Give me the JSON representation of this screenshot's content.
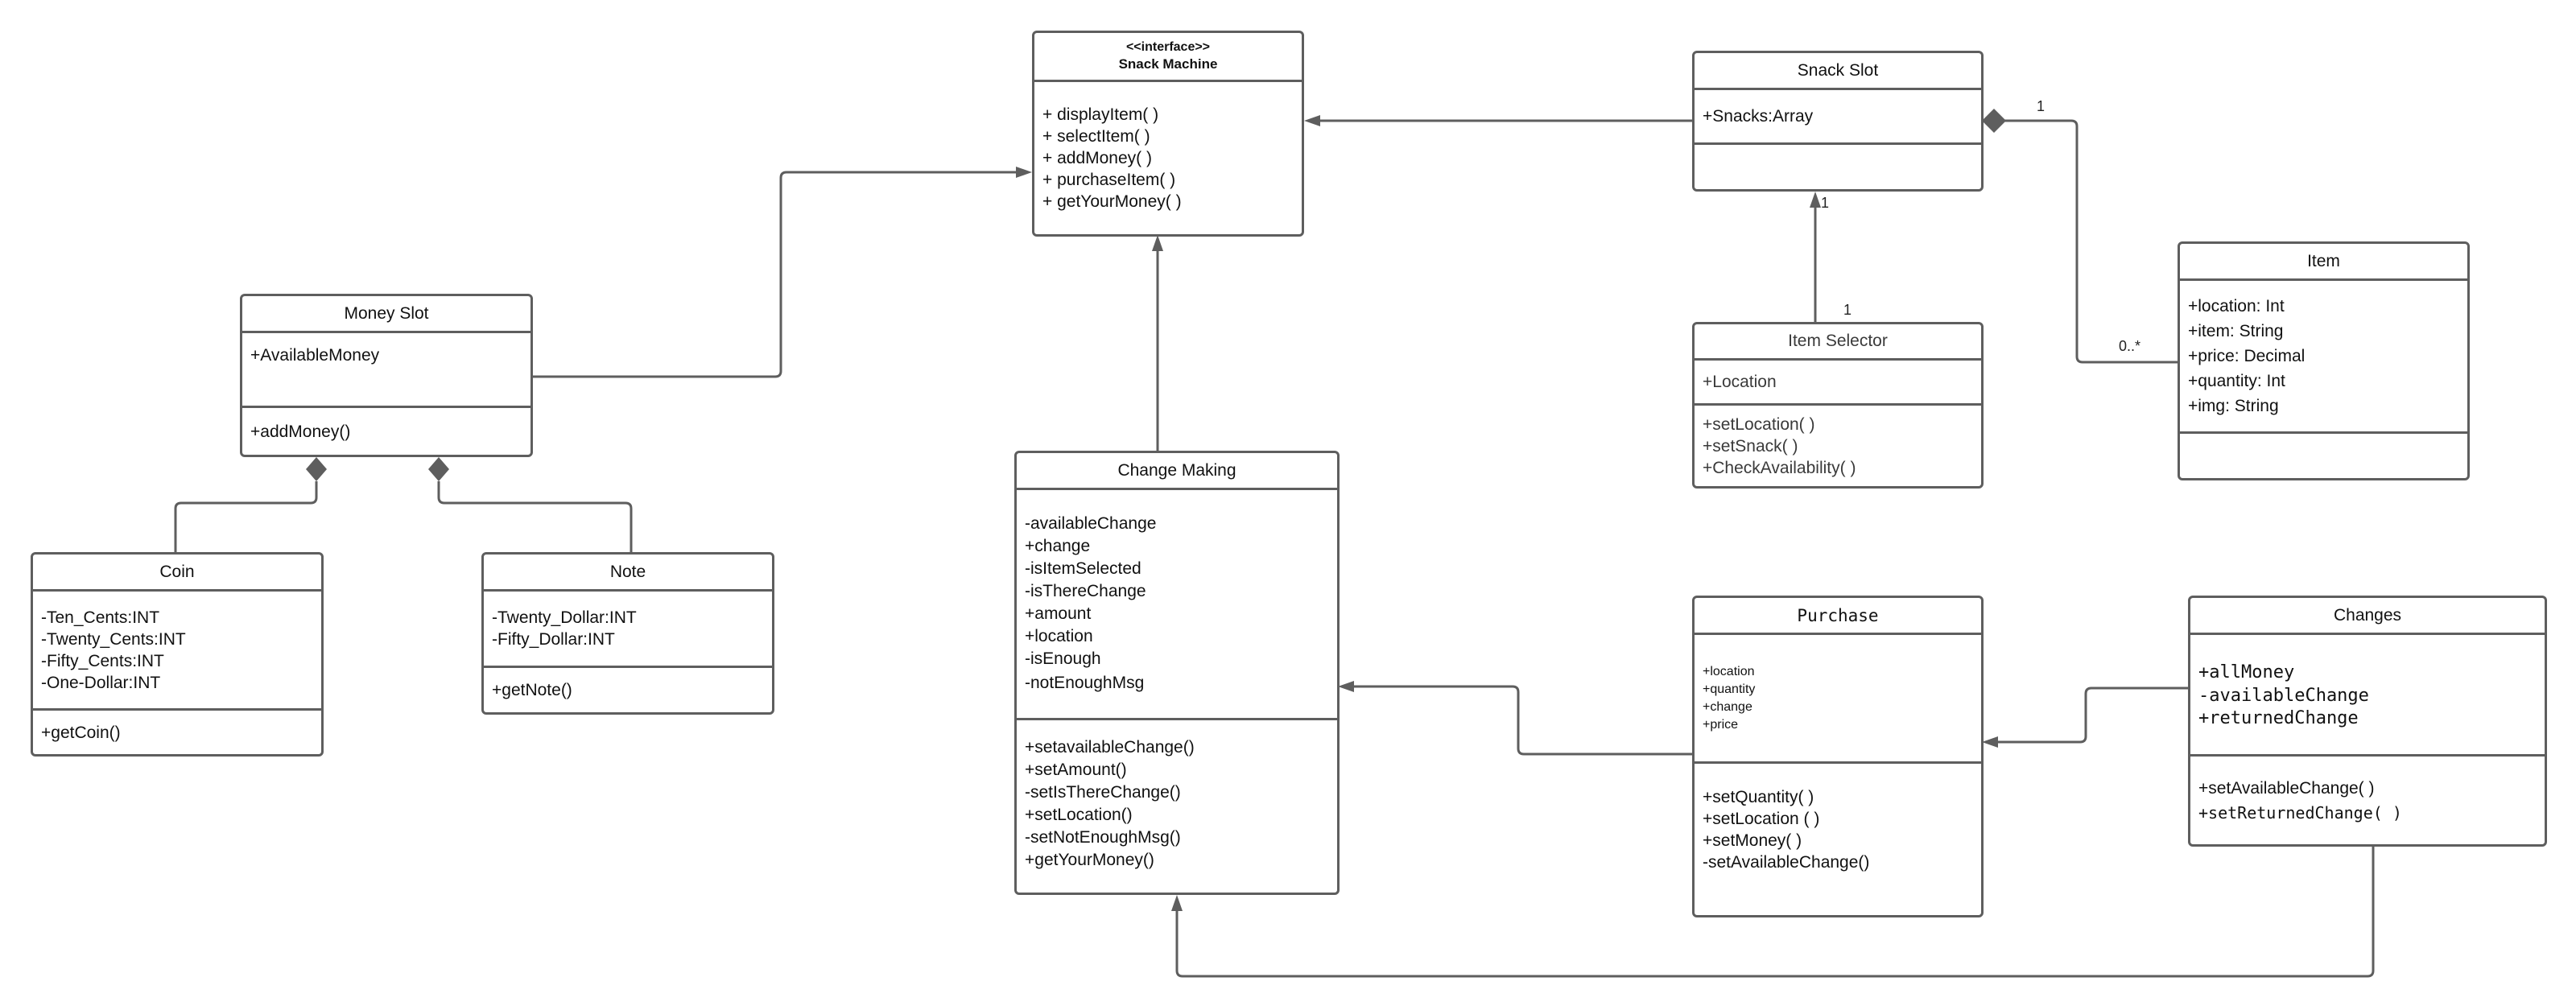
{
  "diagram": {
    "type": "UML class diagram",
    "classes": {
      "snack_machine": {
        "stereotype": "<<interface>>",
        "name": "Snack Machine",
        "attributes": [],
        "operations": [
          "+ displayItem( )",
          "+ selectItem( )",
          "+ addMoney( )",
          "+ purchaseItem( )",
          "+ getYourMoney( )"
        ]
      },
      "snack_slot": {
        "name": "Snack Slot",
        "attributes": [
          "+Snacks:Array"
        ],
        "operations": []
      },
      "item_selector": {
        "name": "Item Selector",
        "attributes": [
          "+Location"
        ],
        "operations": [
          "+setLocation( )",
          "+setSnack( )",
          "+CheckAvailability( )"
        ]
      },
      "item": {
        "name": "Item",
        "attributes": [
          "+location: Int",
          "+item: String",
          "+price: Decimal",
          "+quantity: Int",
          "+img: String"
        ],
        "operations": []
      },
      "money_slot": {
        "name": "Money Slot",
        "attributes": [
          "+AvailableMoney"
        ],
        "operations": [
          "+addMoney()"
        ]
      },
      "coin": {
        "name": "Coin",
        "attributes": [
          "-Ten_Cents:INT",
          "-Twenty_Cents:INT",
          "-Fifty_Cents:INT",
          "-One-Dollar:INT"
        ],
        "operations": [
          "+getCoin()"
        ]
      },
      "note": {
        "name": "Note",
        "attributes": [
          "-Twenty_Dollar:INT",
          "-Fifty_Dollar:INT"
        ],
        "operations": [
          "+getNote()"
        ]
      },
      "change_making": {
        "name": "Change Making",
        "attributes": [
          "-availableChange",
          "+change",
          "-isItemSelected",
          "-isThereChange",
          "+amount",
          "+location",
          "-isEnough",
          "-notEnoughMsg"
        ],
        "operations": [
          "+setavailableChange()",
          "+setAmount()",
          "-setIsThereChange()",
          "+setLocation()",
          "-setNotEnoughMsg()",
          "+getYourMoney()"
        ]
      },
      "purchase": {
        "name": "Purchase",
        "attributes": [
          "+location",
          "+quantity",
          "+change",
          "+price"
        ],
        "operations": [
          "+setQuantity( )",
          "+setLocation ( )",
          "+setMoney( )",
          "-setAvailableChange()"
        ]
      },
      "changes": {
        "name": "Changes",
        "attributes": [
          "+allMoney",
          "-availableChange",
          "+returnedChange"
        ],
        "operations": [
          "+setAvailableChange( )",
          "+setReturnedChange( )"
        ]
      }
    },
    "relationships": [
      {
        "from": "money_slot",
        "to": "snack_machine",
        "kind": "association-arrow"
      },
      {
        "from": "snack_slot",
        "to": "snack_machine",
        "kind": "association-arrow"
      },
      {
        "from": "change_making",
        "to": "snack_machine",
        "kind": "association-arrow"
      },
      {
        "from": "item_selector",
        "to": "snack_slot",
        "kind": "association-arrow",
        "from_multiplicity": "1",
        "to_multiplicity": "1"
      },
      {
        "from": "snack_slot",
        "to": "item",
        "kind": "composition",
        "from_multiplicity": "1",
        "to_multiplicity": "0..*"
      },
      {
        "from": "money_slot",
        "to": "coin",
        "kind": "composition"
      },
      {
        "from": "money_slot",
        "to": "note",
        "kind": "composition"
      },
      {
        "from": "purchase",
        "to": "change_making",
        "kind": "association-arrow"
      },
      {
        "from": "changes",
        "to": "purchase",
        "kind": "association-arrow"
      },
      {
        "from": "changes",
        "to": "change_making",
        "kind": "association-arrow"
      }
    ],
    "multiplicities": {
      "snack_slot_item_selector_top": "1",
      "item_selector_snack_slot_bottom": "1",
      "snack_slot_item_whole": "1",
      "snack_slot_item_part": "0..*"
    },
    "colors": {
      "line": "#5e5e5e",
      "text": "#111111",
      "background": "#ffffff"
    }
  }
}
